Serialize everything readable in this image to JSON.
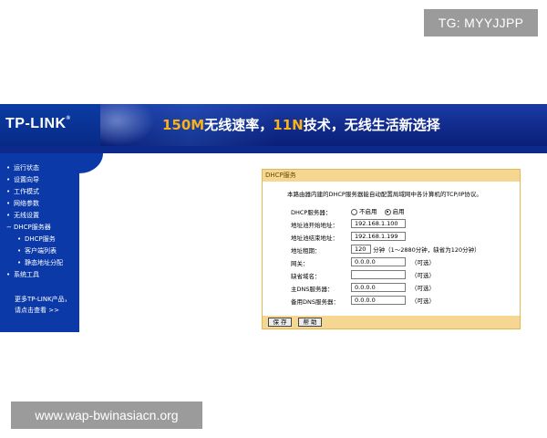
{
  "watermark_top": "TG: MYYJJPP",
  "watermark_bottom": "www.wap-bwinasiacn.org",
  "banner": {
    "logo": "TP-LINK",
    "logo_mark": "®",
    "slogan_highlight_1": "150M",
    "slogan_part_1": "无线速率，",
    "slogan_highlight_2": "11N",
    "slogan_part_2": "技术，无线生活新选择"
  },
  "sidebar": {
    "items": [
      {
        "bullet": "•",
        "label": "运行状态"
      },
      {
        "bullet": "•",
        "label": "设置向导"
      },
      {
        "bullet": "•",
        "label": "工作模式"
      },
      {
        "bullet": "•",
        "label": "网络参数"
      },
      {
        "bullet": "•",
        "label": "无线设置"
      },
      {
        "bullet": "−",
        "label": "DHCP服务器"
      }
    ],
    "subitems": [
      {
        "bullet": "•",
        "label": "DHCP服务"
      },
      {
        "bullet": "•",
        "label": "客户端列表"
      },
      {
        "bullet": "•",
        "label": "静态地址分配"
      }
    ],
    "last_item": {
      "bullet": "•",
      "label": "系统工具"
    },
    "more_line1": "更多TP-LINK产品，",
    "more_line2": "请点击查看 >>"
  },
  "panel": {
    "title": "DHCP服务",
    "description": "本路由器内建的DHCP服务器能自动配置局域网中各计算机的TCP/IP协议。",
    "dhcp_server": {
      "label": "DHCP服务器：",
      "options": [
        "不启用",
        "启用"
      ],
      "selected": "启用"
    },
    "start_address": {
      "label": "地址池开始地址：",
      "value": "192.168.1.100"
    },
    "end_address": {
      "label": "地址池结束地址：",
      "value": "192.168.1.199"
    },
    "lease_time": {
      "label": "地址租期：",
      "value": "120",
      "unit": "分钟",
      "hint": "（1～2880分钟，缺省为120分钟）"
    },
    "gateway": {
      "label": "网关：",
      "value": "0.0.0.0",
      "hint": "（可选）"
    },
    "domain": {
      "label": "缺省域名：",
      "value": "",
      "hint": "（可选）"
    },
    "primary_dns": {
      "label": "主DNS服务器：",
      "value": "0.0.0.0",
      "hint": "（可选）"
    },
    "secondary_dns": {
      "label": "备用DNS服务器：",
      "value": "0.0.0.0",
      "hint": "（可选）"
    },
    "save_label": "保 存",
    "help_label": "帮 助"
  },
  "colors": {
    "nav_blue": "#0b3aa8",
    "banner_blue": "#0b2a8c",
    "panel_header": "#f5d791",
    "panel_border": "#e7b553",
    "slogan_accent": "#f7b21a"
  }
}
